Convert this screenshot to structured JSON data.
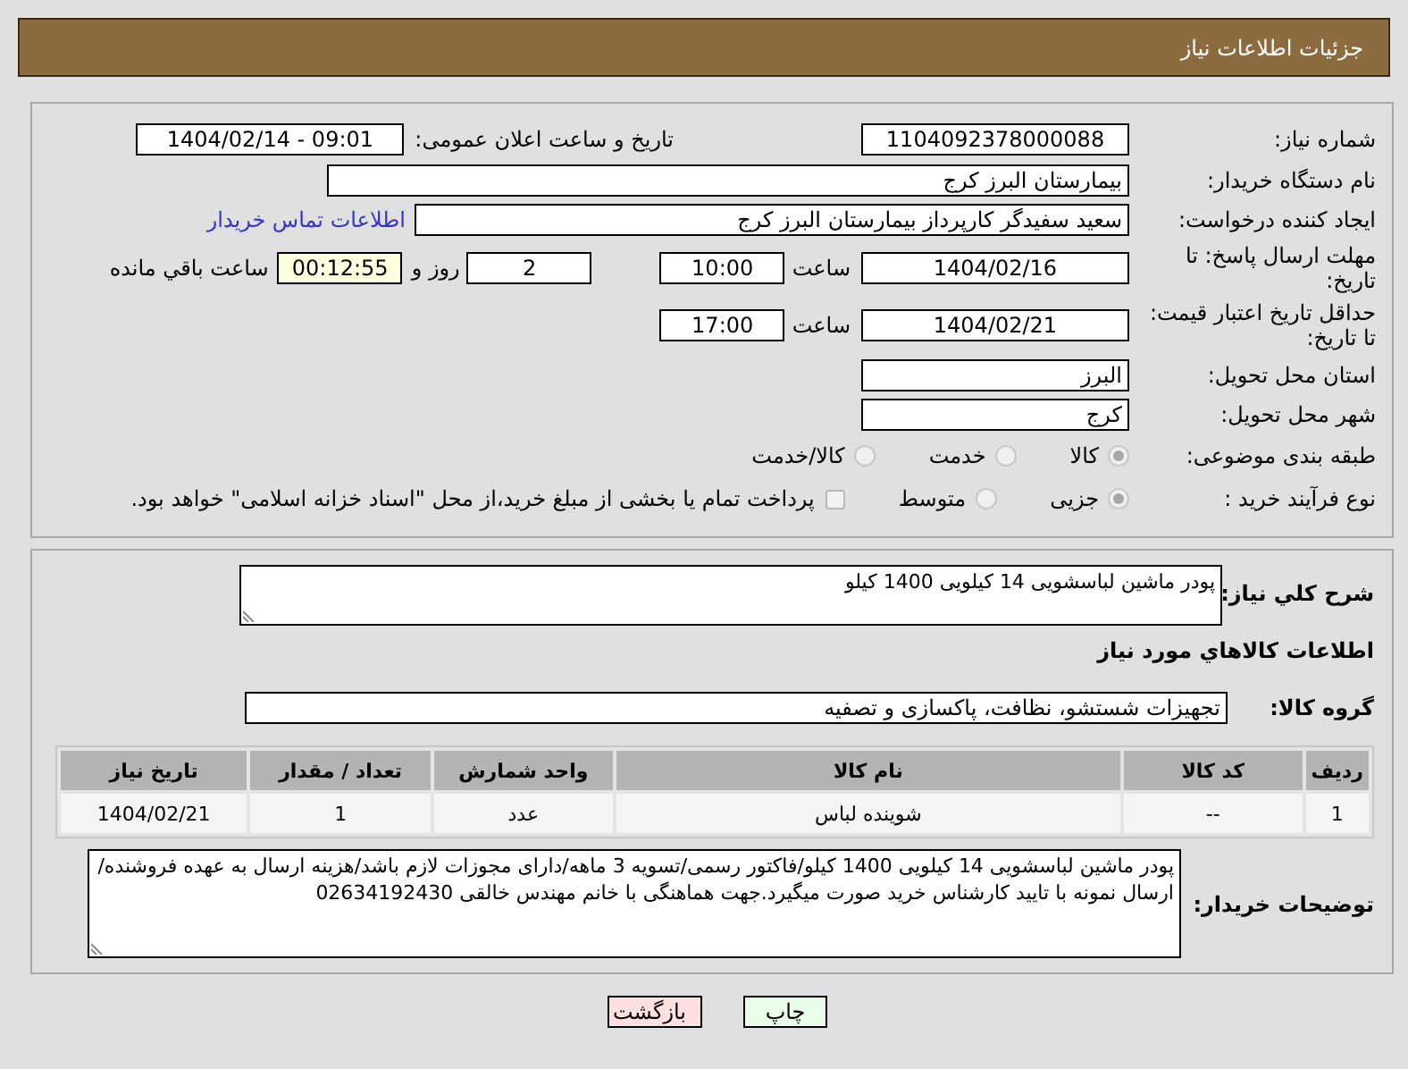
{
  "header": {
    "title": "جزئیات اطلاعات نیاز"
  },
  "details": {
    "need_number": {
      "label": "شماره نیاز:",
      "value": "1104092378000088"
    },
    "announcement": {
      "label": "تاریخ و ساعت اعلان عمومی:",
      "value": "1404/02/14 - 09:01"
    },
    "buyer_org": {
      "label": "نام دستگاه خریدار:",
      "value": "بیمارستان البرز کرج"
    },
    "requester": {
      "label": "ایجاد کننده درخواست:",
      "value": "سعید سفیدگر کارپرداز بیمارستان البرز کرج",
      "contact_link": "اطلاعات تماس خریدار"
    },
    "reply_deadline": {
      "label": "مهلت ارسال پاسخ: تا تاریخ:",
      "date": "1404/02/16",
      "time_label": "ساعت",
      "time": "10:00",
      "days": "2",
      "days_label": "روز و",
      "remaining": "00:12:55",
      "remaining_label": "ساعت باقي مانده"
    },
    "price_validity": {
      "label": "حداقل تاریخ اعتبار قیمت: تا تاریخ:",
      "date": "1404/02/21",
      "time_label": "ساعت",
      "time": "17:00"
    },
    "province": {
      "label": "استان محل تحویل:",
      "value": "البرز"
    },
    "city": {
      "label": "شهر محل تحویل:",
      "value": "کرج"
    },
    "category": {
      "label": "طبقه بندی موضوعی:",
      "options": [
        {
          "label": "كالا",
          "selected": true
        },
        {
          "label": "خدمت",
          "selected": false
        },
        {
          "label": "كالا/خدمت",
          "selected": false
        }
      ]
    },
    "process": {
      "label": "نوع فرآیند خرید :",
      "options": [
        {
          "label": "جزیی",
          "selected": true
        },
        {
          "label": "متوسط",
          "selected": false
        }
      ],
      "treasury": {
        "label": "پرداخت تمام یا بخشی از مبلغ خرید،از محل \"اسناد خزانه اسلامی\" خواهد بود.",
        "checked": false
      }
    }
  },
  "goods": {
    "summary": {
      "label": "شرح كلي نياز:",
      "value": "پودر ماشین لباسشویی 14 کیلویی 1400 کیلو"
    },
    "heading": "اطلاعات كالاهاي مورد نياز",
    "group": {
      "label": "گروه كالا:",
      "value": "تجهیزات شستشو، نظافت، پاکسازی و تصفیه"
    },
    "table": {
      "columns": [
        "ردیف",
        "کد کالا",
        "نام کالا",
        "واحد شمارش",
        "تعداد / مقدار",
        "تاریخ نیاز"
      ],
      "rows": [
        {
          "cells": [
            "1",
            "--",
            "شوینده لباس",
            "عدد",
            "1",
            "1404/02/21"
          ]
        }
      ]
    },
    "notes": {
      "label": "توضیحات خریدار:",
      "value": "پودر ماشین لباسشویی 14 کیلویی 1400 کیلو/فاکتور رسمی/تسویه 3 ماهه/دارای مجوزات لازم باشد/هزینه ارسال به عهده فروشنده/ارسال نمونه با تایید کارشناس خرید صورت میگیرد.جهت هماهنگی با خانم مهندس خالقی 02634192430"
    }
  },
  "actions": [
    {
      "label": "چاپ",
      "kind": "print"
    },
    {
      "label": "بازگشت",
      "kind": "back"
    }
  ]
}
